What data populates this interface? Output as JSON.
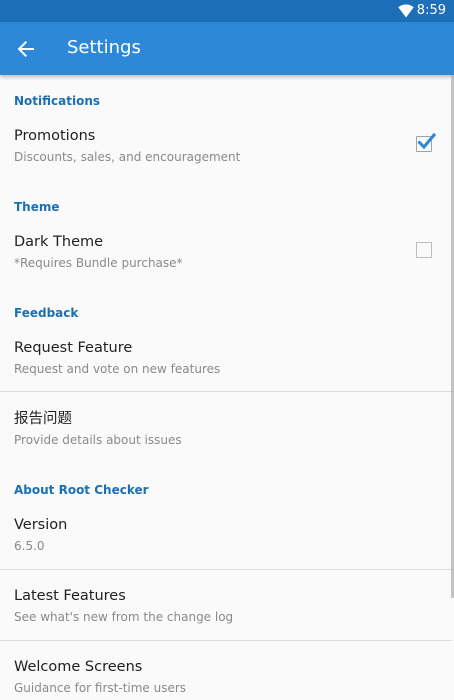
{
  "status_bar": {
    "time": "8:59",
    "icons": [
      "wifi-icon"
    ]
  },
  "app_bar": {
    "title": "Settings",
    "back_icon": "arrow-back-icon"
  },
  "colors": {
    "status_bar": "#1c6fb8",
    "app_bar": "#2e88d8",
    "section_header": "#1a6fb5",
    "check_accent": "#2e88d8"
  },
  "sections": {
    "notifications": {
      "header": "Notifications",
      "promotions": {
        "title": "Promotions",
        "summary": "Discounts, sales, and encouragement",
        "checked": true
      }
    },
    "theme": {
      "header": "Theme",
      "dark_theme": {
        "title": "Dark Theme",
        "summary": "*Requires Bundle purchase*",
        "checked": false
      }
    },
    "feedback": {
      "header": "Feedback",
      "request_feature": {
        "title": "Request Feature",
        "summary": "Request and vote on new features"
      },
      "report_issue": {
        "title": "报告问题",
        "summary": "Provide details about issues"
      }
    },
    "about": {
      "header": "About Root Checker",
      "version": {
        "title": "Version",
        "summary": "6.5.0"
      },
      "latest_features": {
        "title": "Latest Features",
        "summary": "See what's new from the change log"
      },
      "welcome_screens": {
        "title": "Welcome Screens",
        "summary": "Guidance for first-time users"
      }
    }
  }
}
